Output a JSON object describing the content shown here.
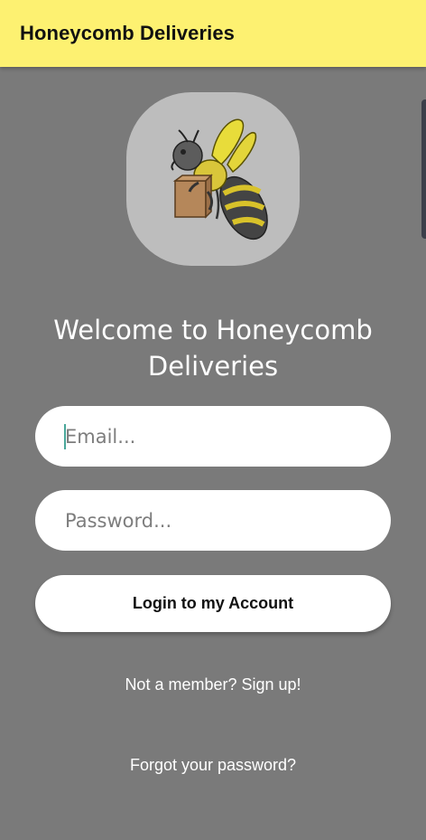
{
  "app_bar": {
    "title": "Honeycomb Deliveries",
    "background": "#fdf171"
  },
  "logo": {
    "icon": "bee-carrying-box-icon"
  },
  "welcome": {
    "line1": "Welcome to Honeycomb",
    "line2": "Deliveries"
  },
  "form": {
    "email_placeholder": "Email...",
    "email_value": "",
    "password_placeholder": "Password...",
    "password_value": "",
    "login_label": "Login to my Account"
  },
  "links": {
    "signup": "Not a member? Sign up!",
    "forgot": "Forgot your password?"
  },
  "colors": {
    "background": "#7a7a7a",
    "accent": "#fdf171",
    "caret": "#4aa79a"
  }
}
